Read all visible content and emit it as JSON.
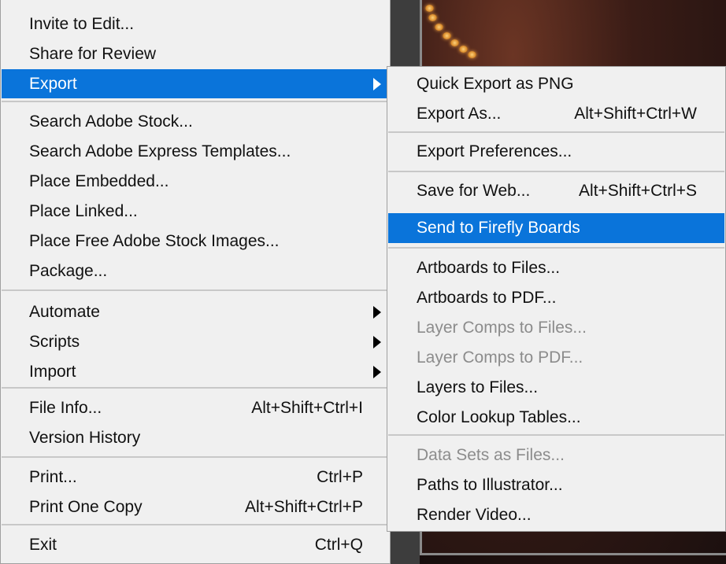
{
  "main_menu": {
    "items": [
      {
        "label": "Invite to Edit...",
        "shortcut": ""
      },
      {
        "label": "Share for Review",
        "shortcut": ""
      },
      {
        "label": "Export",
        "shortcut": ""
      },
      {
        "label": "Search Adobe Stock...",
        "shortcut": ""
      },
      {
        "label": "Search Adobe Express Templates...",
        "shortcut": ""
      },
      {
        "label": "Place Embedded...",
        "shortcut": ""
      },
      {
        "label": "Place Linked...",
        "shortcut": ""
      },
      {
        "label": "Place Free Adobe Stock Images...",
        "shortcut": ""
      },
      {
        "label": "Package...",
        "shortcut": ""
      },
      {
        "label": "Automate",
        "shortcut": ""
      },
      {
        "label": "Scripts",
        "shortcut": ""
      },
      {
        "label": "Import",
        "shortcut": ""
      },
      {
        "label": "File Info...",
        "shortcut": "Alt+Shift+Ctrl+I"
      },
      {
        "label": "Version History",
        "shortcut": ""
      },
      {
        "label": "Print...",
        "shortcut": "Ctrl+P"
      },
      {
        "label": "Print One Copy",
        "shortcut": "Alt+Shift+Ctrl+P"
      },
      {
        "label": "Exit",
        "shortcut": "Ctrl+Q"
      }
    ]
  },
  "export_submenu": {
    "items": [
      {
        "label": "Quick Export as PNG",
        "shortcut": ""
      },
      {
        "label": "Export As...",
        "shortcut": "Alt+Shift+Ctrl+W"
      },
      {
        "label": "Export Preferences...",
        "shortcut": ""
      },
      {
        "label": "Save for Web...",
        "shortcut": "Alt+Shift+Ctrl+S"
      },
      {
        "label": "Send to Firefly Boards",
        "shortcut": ""
      },
      {
        "label": "Artboards to Files...",
        "shortcut": ""
      },
      {
        "label": "Artboards to PDF...",
        "shortcut": ""
      },
      {
        "label": "Layer Comps to Files...",
        "shortcut": ""
      },
      {
        "label": "Layer Comps to PDF...",
        "shortcut": ""
      },
      {
        "label": "Layers to Files...",
        "shortcut": ""
      },
      {
        "label": "Color Lookup Tables...",
        "shortcut": ""
      },
      {
        "label": "Data Sets as Files...",
        "shortcut": ""
      },
      {
        "label": "Paths to Illustrator...",
        "shortcut": ""
      },
      {
        "label": "Render Video...",
        "shortcut": ""
      }
    ]
  },
  "colors": {
    "menu_bg": "#f0f0f0",
    "highlight": "#0a74da",
    "disabled_text": "#8c8c8c"
  }
}
